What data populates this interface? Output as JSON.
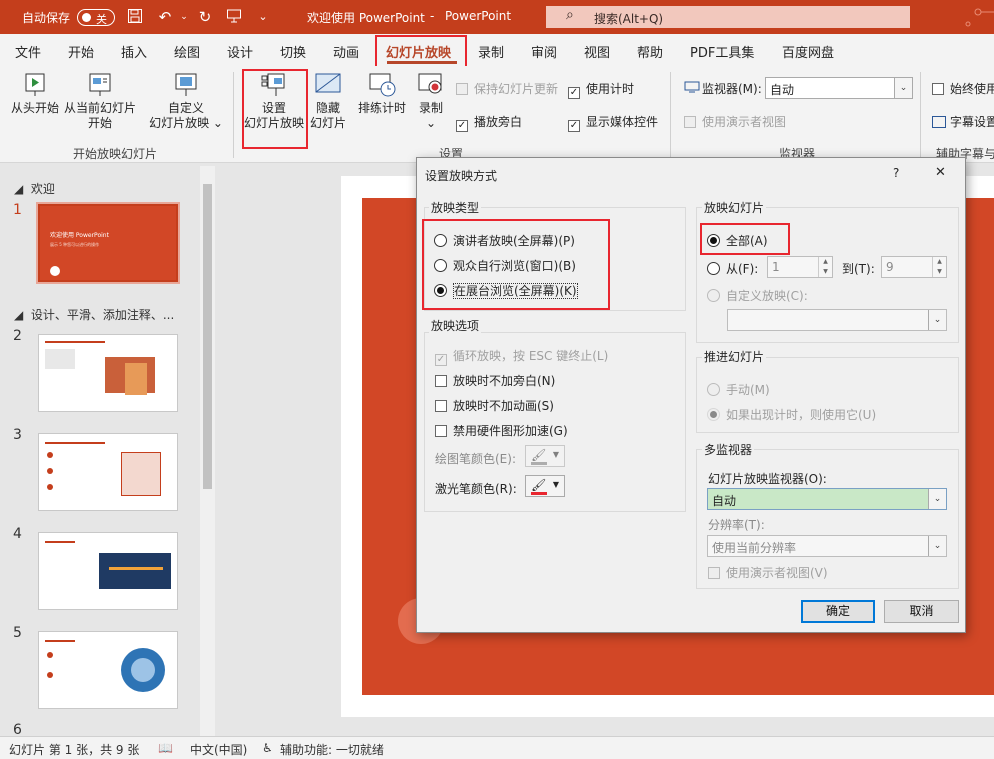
{
  "titlebar": {
    "autosave_label": "自动保存",
    "autosave_state": "关",
    "doc_title": "欢迎使用 PowerPoint",
    "separator": "-",
    "app_name": "PowerPoint",
    "search_placeholder": "搜索(Alt+Q)"
  },
  "tabs": [
    "文件",
    "开始",
    "插入",
    "绘图",
    "设计",
    "切换",
    "动画",
    "幻灯片放映",
    "录制",
    "审阅",
    "视图",
    "帮助",
    "PDF工具集",
    "百度网盘"
  ],
  "ribbon": {
    "from_start": "从头开始",
    "from_current_l1": "从当前幻灯片",
    "from_current_l2": "开始",
    "custom_l1": "自定义",
    "custom_l2": "幻灯片放映 ⌄",
    "group_start": "开始放映幻灯片",
    "setup_l1": "设置",
    "setup_l2": "幻灯片放映",
    "hide_l1": "隐藏",
    "hide_l2": "幻灯片",
    "rehearse": "排练计时",
    "record": "录制",
    "record_arrow": "⌄",
    "keep_updated": "保持幻灯片更新",
    "play_narration": "播放旁白",
    "use_timings": "使用计时",
    "show_media": "显示媒体控件",
    "group_setup": "设置",
    "monitor_label": "监视器(M):",
    "monitor_value": "自动",
    "presenter_view": "使用演示者视图",
    "group_monitors": "监视器",
    "always_use": "始终使用",
    "subtitle_settings": "字幕设置",
    "group_captions": "辅助字幕与"
  },
  "slides_panel": {
    "section1": "欢迎",
    "section2": "设计、平滑、添加注释、...",
    "slide1_title": "欢迎使用 PowerPoint",
    "slide1_sub": "展示 5 种您可以进行的操作",
    "numbers": [
      "1",
      "2",
      "3",
      "4",
      "5",
      "6"
    ]
  },
  "status": {
    "slide_info": "幻灯片 第 1 张，共 9 张",
    "language": "中文(中国)",
    "accessibility": "辅助功能: 一切就绪"
  },
  "dialog": {
    "title": "设置放映方式",
    "help": "?",
    "close": "✕",
    "show_type_title": "放映类型",
    "show_type_options": [
      "演讲者放映(全屏幕)(P)",
      "观众自行浏览(窗口)(B)",
      "在展台浏览(全屏幕)(K)"
    ],
    "show_options_title": "放映选项",
    "loop": "循环放映，按 ESC 键终止(L)",
    "no_narration": "放映时不加旁白(N)",
    "no_animation": "放映时不加动画(S)",
    "disable_hw": "禁用硬件图形加速(G)",
    "pen_color": "绘图笔颜色(E):",
    "laser_color": "激光笔颜色(R):",
    "show_slides_title": "放映幻灯片",
    "all": "全部(A)",
    "from": "从(F):",
    "from_value": "1",
    "to": "到(T):",
    "to_value": "9",
    "custom_show": "自定义放映(C):",
    "advance_title": "推进幻灯片",
    "manual": "手动(M)",
    "use_timings_if": "如果出现计时，则使用它(U)",
    "multi_monitor_title": "多监视器",
    "monitor_label": "幻灯片放映监视器(O):",
    "monitor_value": "自动",
    "resolution_label": "分辨率(T):",
    "resolution_value": "使用当前分辨率",
    "presenter_view": "使用演示者视图(V)",
    "ok": "确定",
    "cancel": "取消"
  },
  "colors": {
    "accent": "#c43e1c",
    "slide": "#d24726",
    "highlight": "#e8262f",
    "selected_combo": "#c9e8c7"
  }
}
